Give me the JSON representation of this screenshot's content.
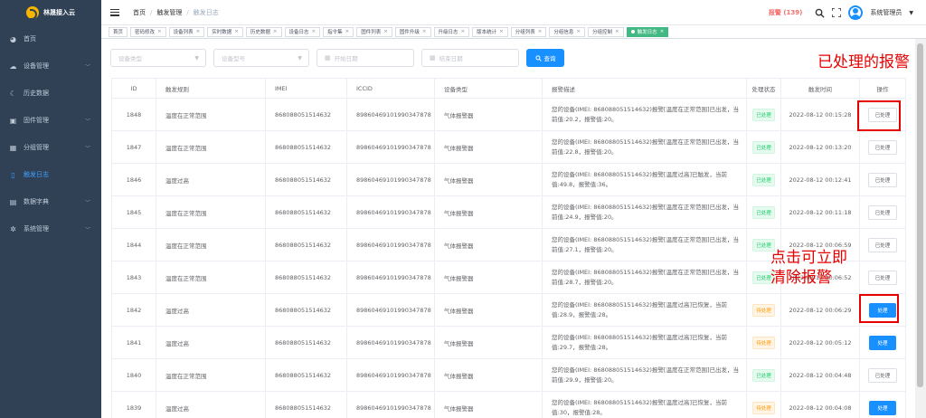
{
  "brand": {
    "name": "林晟接入云"
  },
  "sidebar": {
    "items": [
      {
        "label": "首页",
        "icon": "dashboard-icon",
        "has_children": false,
        "active": false
      },
      {
        "label": "设备管理",
        "icon": "cloud-icon",
        "has_children": true,
        "active": false
      },
      {
        "label": "历史数据",
        "icon": "moon-icon",
        "has_children": false,
        "active": false
      },
      {
        "label": "固件管理",
        "icon": "chip-icon",
        "has_children": true,
        "active": false
      },
      {
        "label": "分组管理",
        "icon": "grid-icon",
        "has_children": true,
        "active": false
      },
      {
        "label": "触发日志",
        "icon": "log-icon",
        "has_children": false,
        "active": true
      },
      {
        "label": "数据字典",
        "icon": "book-icon",
        "has_children": true,
        "active": false
      },
      {
        "label": "系统管理",
        "icon": "gear-icon",
        "has_children": true,
        "active": false
      }
    ]
  },
  "header": {
    "breadcrumb": [
      "首页",
      "触发管理",
      "触发日志"
    ],
    "alarm_label": "报警 (139)",
    "user_name": "系统管理员"
  },
  "tags": [
    {
      "label": "首页",
      "closable": false,
      "active": false
    },
    {
      "label": "密码修改",
      "closable": true,
      "active": false
    },
    {
      "label": "设备列表",
      "closable": true,
      "active": false
    },
    {
      "label": "实时数据",
      "closable": true,
      "active": false
    },
    {
      "label": "历史数据",
      "closable": true,
      "active": false
    },
    {
      "label": "设备日志",
      "closable": true,
      "active": false
    },
    {
      "label": "指令集",
      "closable": true,
      "active": false
    },
    {
      "label": "固件列表",
      "closable": true,
      "active": false
    },
    {
      "label": "固件升级",
      "closable": true,
      "active": false
    },
    {
      "label": "升级日志",
      "closable": true,
      "active": false
    },
    {
      "label": "版本统计",
      "closable": true,
      "active": false
    },
    {
      "label": "分组列表",
      "closable": true,
      "active": false
    },
    {
      "label": "分组信息",
      "closable": true,
      "active": false
    },
    {
      "label": "分组控制",
      "closable": true,
      "active": false
    },
    {
      "label": "触发日志",
      "closable": true,
      "active": true
    }
  ],
  "filters": {
    "device_type_placeholder": "设备类型",
    "device_model_placeholder": "设备型号",
    "start_date_placeholder": "开始日期",
    "end_date_placeholder": "结束日期",
    "search_label": "查询"
  },
  "table": {
    "columns": [
      "ID",
      "触发规则",
      "IMEI",
      "ICCID",
      "设备类型",
      "报警描述",
      "处理状态",
      "触发时间",
      "操作"
    ],
    "rows": [
      {
        "id": "1848",
        "rule": "温度在正常范围",
        "imei": "868088051514632",
        "iccid": "89860469101990347878",
        "type": "气体报警器",
        "desc": "您的设备(IMEI: 868088051514632)报警[温度在正常范围]已出发，当前值:20.2，报警值:20。",
        "status": "已处理",
        "status_kind": "done",
        "time": "2022-08-12 00:15:28",
        "action": "已处理",
        "action_kind": "default"
      },
      {
        "id": "1847",
        "rule": "温度在正常范围",
        "imei": "868088051514632",
        "iccid": "89860469101990347878",
        "type": "气体报警器",
        "desc": "您的设备(IMEI: 868088051514632)报警[温度在正常范围]已出发，当前值:22.8，报警值:20。",
        "status": "已处理",
        "status_kind": "done",
        "time": "2022-08-12 00:13:20",
        "action": "已处理",
        "action_kind": "default"
      },
      {
        "id": "1846",
        "rule": "温度过高",
        "imei": "868088051514632",
        "iccid": "89860469101990347878",
        "type": "气体报警器",
        "desc": "您的设备(IMEI: 868088051514632)报警[温度过高]已触发，当前值:49.8，报警值:36。",
        "status": "已处理",
        "status_kind": "done",
        "time": "2022-08-12 00:12:41",
        "action": "已处理",
        "action_kind": "default"
      },
      {
        "id": "1845",
        "rule": "温度在正常范围",
        "imei": "868088051514632",
        "iccid": "89860469101990347878",
        "type": "气体报警器",
        "desc": "您的设备(IMEI: 868088051514632)报警[温度在正常范围]已出发，当前值:24.9，报警值:20。",
        "status": "已处理",
        "status_kind": "done",
        "time": "2022-08-12 00:11:18",
        "action": "已处理",
        "action_kind": "default"
      },
      {
        "id": "1844",
        "rule": "温度在正常范围",
        "imei": "868088051514632",
        "iccid": "89860469101990347878",
        "type": "气体报警器",
        "desc": "您的设备(IMEI: 868088051514632)报警[温度在正常范围]已出发，当前值:27.1，报警值:20。",
        "status": "已处理",
        "status_kind": "done",
        "time": "2022-08-12 00:06:59",
        "action": "已处理",
        "action_kind": "default"
      },
      {
        "id": "1843",
        "rule": "温度在正常范围",
        "imei": "868088051514632",
        "iccid": "89860469101990347878",
        "type": "气体报警器",
        "desc": "您的设备(IMEI: 868088051514632)报警[温度在正常范围]已出发，当前值:28.7，报警值:20。",
        "status": "已处理",
        "status_kind": "done",
        "time": "2022-08-12 00:06:52",
        "action": "已处理",
        "action_kind": "default"
      },
      {
        "id": "1842",
        "rule": "温度过高",
        "imei": "868088051514632",
        "iccid": "89860469101990347878",
        "type": "气体报警器",
        "desc": "您的设备(IMEI: 868088051514632)报警[温度过高]已恢复，当前值:28.9，报警值:28。",
        "status": "待处理",
        "status_kind": "pending",
        "time": "2022-08-12 00:06:29",
        "action": "处理",
        "action_kind": "primary"
      },
      {
        "id": "1841",
        "rule": "温度过高",
        "imei": "868088051514632",
        "iccid": "89860469101990347878",
        "type": "气体报警器",
        "desc": "您的设备(IMEI: 868088051514632)报警[温度过高]已恢复，当前值:29.7，报警值:28。",
        "status": "待处理",
        "status_kind": "pending",
        "time": "2022-08-12 00:05:12",
        "action": "处理",
        "action_kind": "primary"
      },
      {
        "id": "1840",
        "rule": "温度在正常范围",
        "imei": "868088051514632",
        "iccid": "89860469101990347878",
        "type": "气体报警器",
        "desc": "您的设备(IMEI: 868088051514632)报警[温度在正常范围]已出发，当前值:29.9，报警值:20。",
        "status": "已处理",
        "status_kind": "done",
        "time": "2022-08-12 00:04:48",
        "action": "已处理",
        "action_kind": "default"
      },
      {
        "id": "1839",
        "rule": "温度过高",
        "imei": "868088051514632",
        "iccid": "89860469101990347878",
        "type": "气体报警器",
        "desc": "您的设备(IMEI: 868088051514632)报警[温度过高]已恢复，当前值:30，报警值:28。",
        "status": "待处理",
        "status_kind": "pending",
        "time": "2022-08-12 00:04:08",
        "action": "处理",
        "action_kind": "primary"
      }
    ]
  },
  "annotations": {
    "processed_note": "已处理的报警",
    "click_note_line1": "点击可立即",
    "click_note_line2": "清除报警"
  },
  "colors": {
    "sidebar_bg": "#304156",
    "accent": "#1890ff",
    "alarm": "#f56c6c",
    "active_tag": "#42b983",
    "annotation": "#e60000"
  }
}
